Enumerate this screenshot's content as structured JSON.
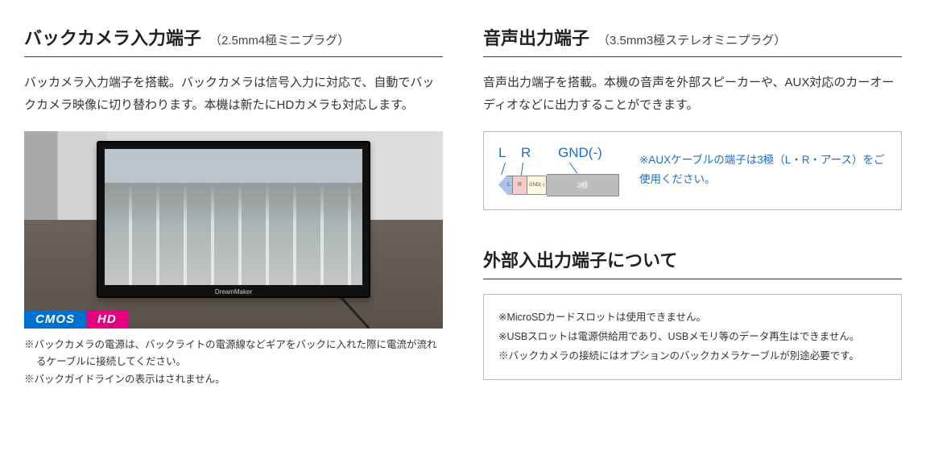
{
  "left": {
    "title": "バックカメラ入力端子",
    "subtitle": "（2.5mm4極ミニプラグ）",
    "body": "バッカメラ入力端子を搭載。バックカメラは信号入力に対応で、自動でバックカメラ映像に切り替わります。本機は新たにHDカメラも対応します。",
    "monitor_brand": "DreamMaker",
    "badge_cmos": "CMOS",
    "badge_hd": "HD",
    "notes": [
      "※バックカメラの電源は、バックライトの電源線などギアをバックに入れた際に電流が流れるケーブルに接続してください。",
      "※バックガイドラインの表示はされません。"
    ]
  },
  "right_audio": {
    "title": "音声出力端子",
    "subtitle": "（3.5mm3極ステレオミニプラグ）",
    "body": "音声出力端子を搭載。本機の音声を外部スピーカーや、AUX対応のカーオーディオなどに出力することができます。",
    "plug": {
      "l": "L",
      "r": "R",
      "gnd": "GND(-)",
      "tip_mark": "L",
      "ring1_mark": "R",
      "ring2_mark": "GND(-)",
      "sleeve_mark": "3極"
    },
    "aux_note": "※AUXケーブルの端子は3極（L・R・アース）をご使用ください。"
  },
  "right_io": {
    "title": "外部入出力端子について",
    "notes": [
      "※MicroSDカードスロットは使用できません。",
      "※USBスロットは電源供給用であり、USBメモリ等のデータ再生はできません。",
      "※バックカメラの接続にはオプションのバックカメラケーブルが別途必要です。"
    ]
  }
}
